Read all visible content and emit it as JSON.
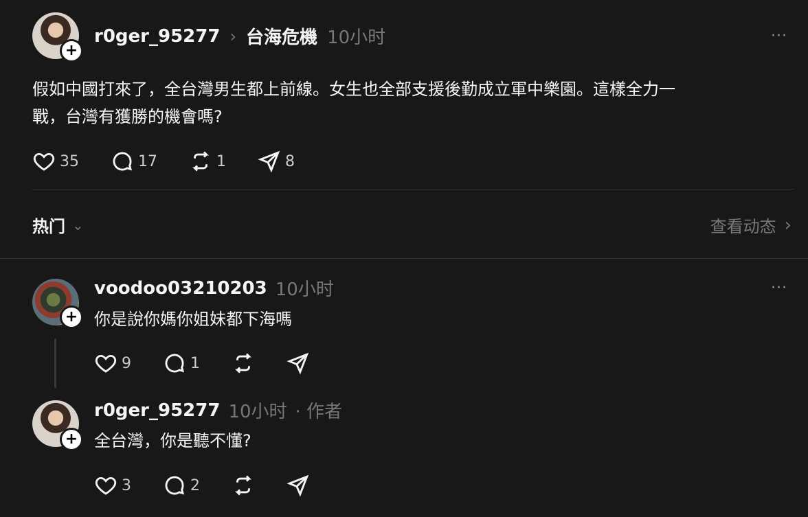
{
  "post": {
    "username": "r0ger_95277",
    "separator": "›",
    "topic": "台海危機",
    "time": "10小时",
    "more": "···",
    "text_line1": "假如中國打來了，全台灣男生都上前線。女生也全部支援後勤成立軍中樂園。這樣全力一",
    "text_line2": "戰，台灣有獲勝的機會嗎?",
    "likes": "35",
    "comments": "17",
    "reposts": "1",
    "shares": "8"
  },
  "sort_bar": {
    "label": "热门",
    "chevron": "⌄",
    "view_activity": "查看动态",
    "view_chevron": "›"
  },
  "replies": [
    {
      "username": "voodoo03210203",
      "time": "10小时",
      "text": "你是說你媽你姐妹都下海嗎",
      "likes": "9",
      "comments": "1",
      "more": "···"
    },
    {
      "username": "r0ger_95277",
      "time": "10小时",
      "author_tag": "· 作者",
      "text": "全台灣，你是聽不懂?",
      "likes": "3",
      "comments": "2"
    }
  ],
  "avatar_badge": "+",
  "colors": {
    "background": "#181818",
    "text": "#f3f5f7",
    "muted": "#777777",
    "divider": "#333333"
  }
}
